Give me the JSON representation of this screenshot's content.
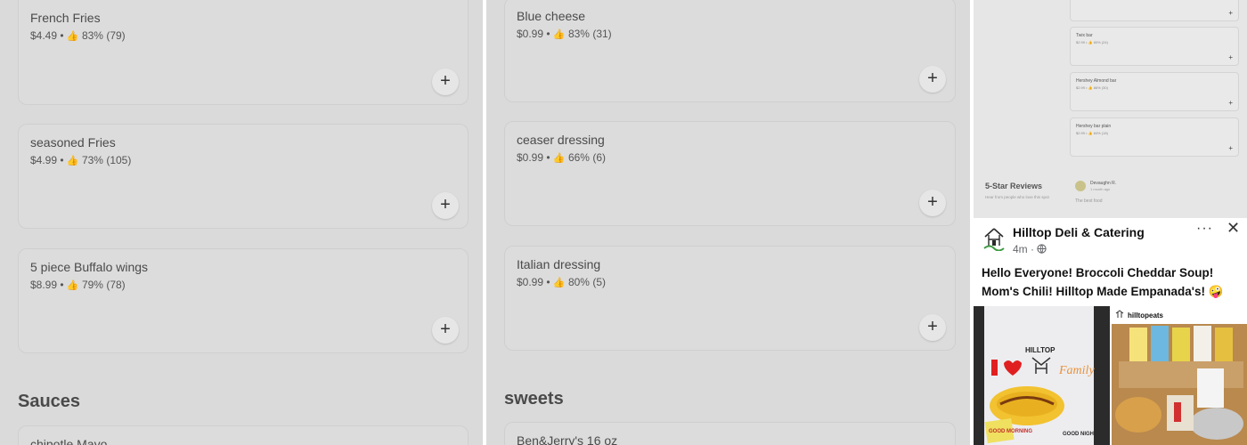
{
  "left_panel": {
    "items": [
      {
        "name": "French Fries",
        "price": "$4.49",
        "rating": "83%",
        "count": "(79)"
      },
      {
        "name": "seasoned Fries",
        "price": "$4.99",
        "rating": "73%",
        "count": "(105)"
      },
      {
        "name": "5 piece Buffalo wings",
        "price": "$8.99",
        "rating": "79%",
        "count": "(78)"
      }
    ],
    "section_title": "Sauces",
    "partial_item": "chipotle Mayo"
  },
  "mid_panel": {
    "items": [
      {
        "name": "Blue cheese",
        "price": "$0.99",
        "rating": "83%",
        "count": "(31)"
      },
      {
        "name": "ceaser dressing",
        "price": "$0.99",
        "rating": "66%",
        "count": "(6)"
      },
      {
        "name": "Italian dressing",
        "price": "$0.99",
        "rating": "80%",
        "count": "(5)"
      }
    ],
    "section_title": "sweets",
    "partial_item": "Ben&Jerry's 16 oz"
  },
  "right_top": {
    "mini_items": [
      {
        "name": "Twix bar",
        "meta": "$2.99 • 👍 80% (24)"
      },
      {
        "name": "Hershey Almond bar",
        "meta": "$2.99 • 👍 86% (30)"
      },
      {
        "name": "Hershey bar plain",
        "meta": "$2.99 • 👍 84% (18)"
      }
    ],
    "reviews_title": "5-Star Reviews",
    "reviews_subtitle": "Hear from people who love this spot",
    "reviewer_name": "Devaughn R.",
    "reviewer_time": "1 month ago",
    "review_text": "The best food"
  },
  "facebook_post": {
    "page_name": "Hilltop Deli & Catering",
    "time": "4m ·",
    "more_icon": "···",
    "close_icon": "✕",
    "text": "Hello Everyone!  Broccoli Cheddar Soup!  Mom's Chili!  Hilltop Made Empanada's! 🤪",
    "image1_top": "HILLTOP",
    "image1_bottom_left": "GOOD MORNING",
    "image1_bottom_right": "GOOD NIGHT",
    "image2_account": "hilltopeats"
  },
  "icons": {
    "add": "+",
    "thumb": "👍"
  },
  "colors": {
    "panel_bg": "#dadada",
    "card_border": "#cfcfcf",
    "text": "#4a4a4a",
    "fb_text": "#111111"
  }
}
